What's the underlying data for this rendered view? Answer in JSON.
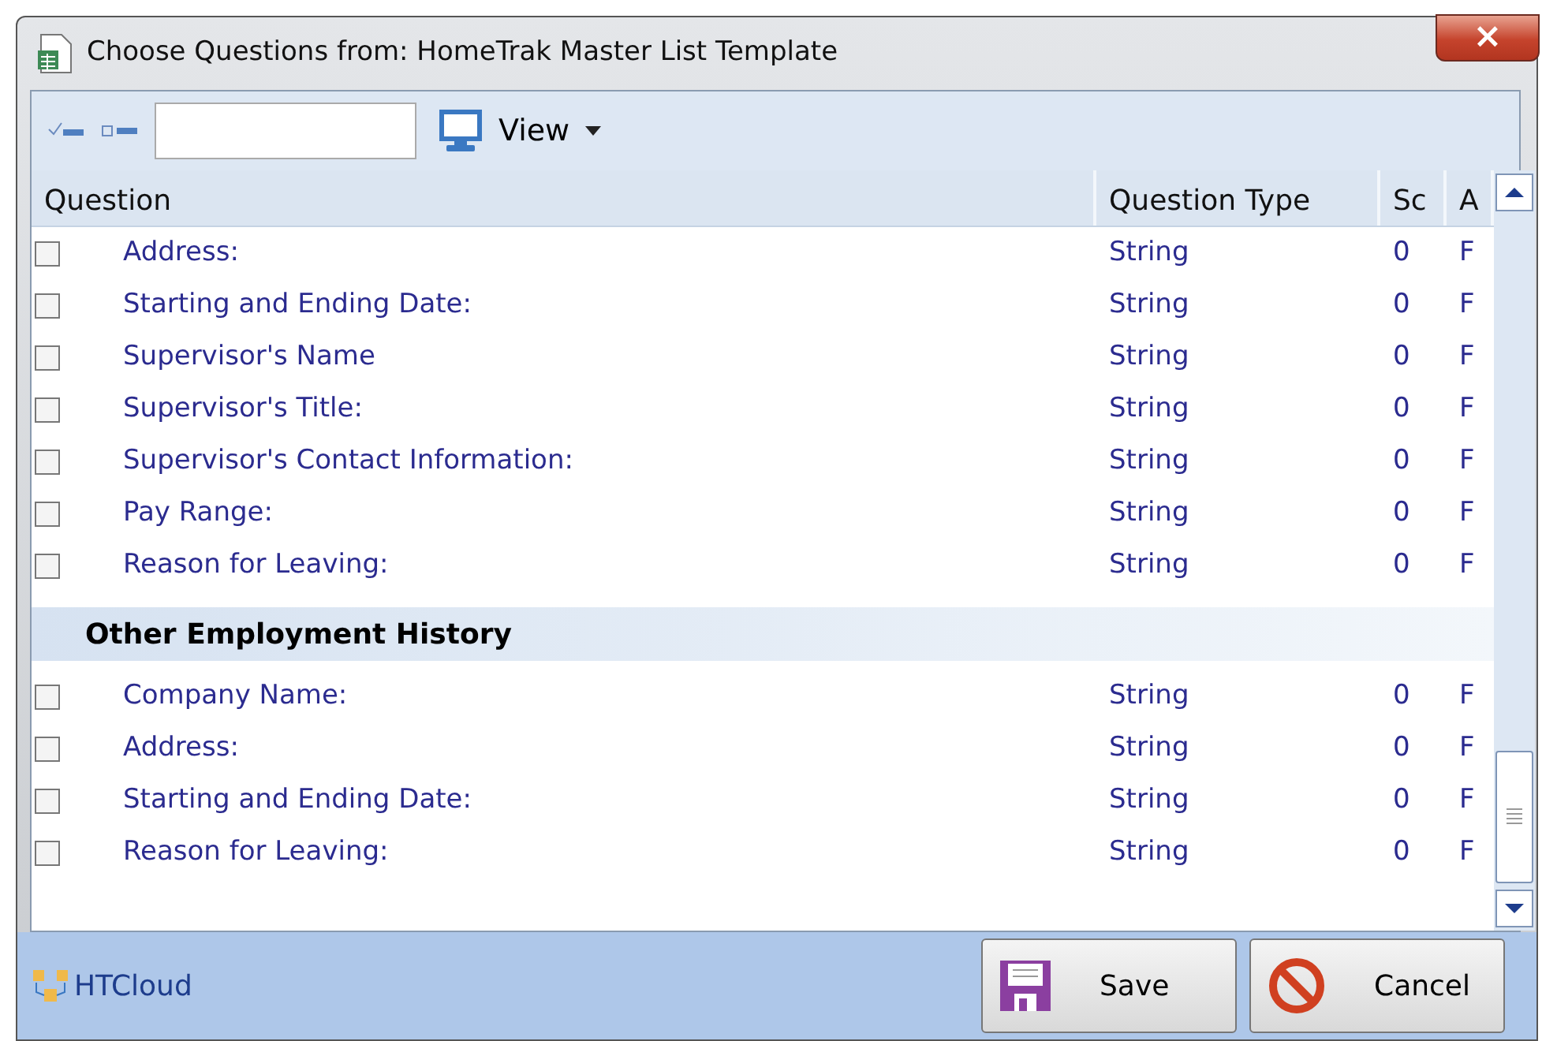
{
  "window": {
    "title": "Choose Questions from: HomeTrak Master List Template",
    "close": "×"
  },
  "toolbar": {
    "view": "View"
  },
  "table": {
    "columns": [
      "Question",
      "Question Type",
      "Sc",
      "A"
    ],
    "rows": [
      {
        "kind": "question",
        "checked": false,
        "question": "Address:",
        "type": "String",
        "sc": "0",
        "a": "F"
      },
      {
        "kind": "question",
        "checked": false,
        "question": "Starting and Ending Date:",
        "type": "String",
        "sc": "0",
        "a": "F"
      },
      {
        "kind": "question",
        "checked": false,
        "question": "Supervisor's Name",
        "type": "String",
        "sc": "0",
        "a": "F"
      },
      {
        "kind": "question",
        "checked": false,
        "question": "Supervisor's Title:",
        "type": "String",
        "sc": "0",
        "a": "F"
      },
      {
        "kind": "question",
        "checked": false,
        "question": "Supervisor's Contact Information:",
        "type": "String",
        "sc": "0",
        "a": "F"
      },
      {
        "kind": "question",
        "checked": false,
        "question": "Pay Range:",
        "type": "String",
        "sc": "0",
        "a": "F"
      },
      {
        "kind": "question",
        "checked": false,
        "question": "Reason for Leaving:",
        "type": "String",
        "sc": "0",
        "a": "F"
      },
      {
        "kind": "group",
        "question": "Other Employment History"
      },
      {
        "kind": "question",
        "checked": false,
        "question": "Company Name:",
        "type": "String",
        "sc": "0",
        "a": "F"
      },
      {
        "kind": "question",
        "checked": false,
        "question": "Address:",
        "type": "String",
        "sc": "0",
        "a": "F"
      },
      {
        "kind": "question",
        "checked": false,
        "question": "Starting and Ending Date:",
        "type": "String",
        "sc": "0",
        "a": "F"
      },
      {
        "kind": "question",
        "checked": false,
        "question": "Reason for Leaving:",
        "type": "String",
        "sc": "0",
        "a": "F"
      }
    ]
  },
  "footer": {
    "brand": "HTCloud",
    "buttons": [
      {
        "kind": "save",
        "label": "Save"
      },
      {
        "kind": "cancel",
        "label": "Cancel"
      }
    ]
  }
}
